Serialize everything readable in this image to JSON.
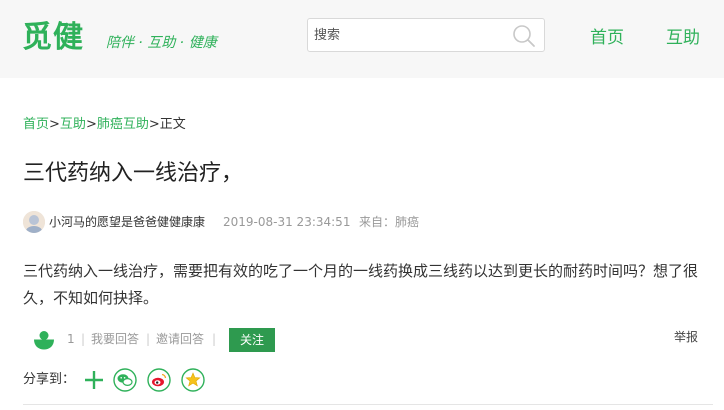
{
  "header": {
    "logo_text": "觅健",
    "slogan": "陪伴 · 互助 · 健康",
    "search_placeholder": "搜索",
    "nav": {
      "home": "首页",
      "help": "互助"
    }
  },
  "breadcrumb": {
    "items": [
      "首页",
      "互助",
      "肺癌互助"
    ],
    "separator": ">",
    "current": "正文"
  },
  "post": {
    "title": "三代药纳入一线治疗，",
    "author": "小河马的愿望是爸爸健健康康",
    "time": "2019-08-31 23:34:51",
    "source": "来自：肺癌",
    "content": "三代药纳入一线治疗，需要把有效的吃了一个月的一线药换成三线药以达到更长的耐药时间吗？想了很久，不知如何抉择。"
  },
  "actions": {
    "like_count": "1",
    "sep": "|",
    "answer": "我要回答",
    "invite": "邀请回答",
    "follow": "关注",
    "report": "举报"
  },
  "share": {
    "label": "分享到：",
    "icons": [
      "plus-icon",
      "wechat-icon",
      "weibo-icon",
      "qzone-icon"
    ]
  },
  "colors": {
    "brand_green": "#2fb15a",
    "button_green": "#2e9a4f"
  }
}
